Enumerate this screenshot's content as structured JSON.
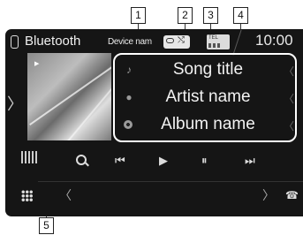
{
  "callouts": {
    "c1": "1",
    "c2": "2",
    "c3": "3",
    "c4": "4",
    "c5": "5"
  },
  "header": {
    "title": "Bluetooth",
    "device_name": "Device nam",
    "tel_label": "TEL",
    "clock": "10:00",
    "icons": [
      "phone-icon",
      "repeat-icon",
      "shuffle-icon",
      "signal-icon"
    ]
  },
  "track": {
    "song_title": "Song title",
    "artist_name": "Artist name",
    "album_name": "Album name"
  },
  "controls": [
    "eq-icon",
    "search-icon",
    "previous-icon",
    "play-icon",
    "pause-icon",
    "next-icon"
  ],
  "glyphs": {
    "side_chevron": "〉",
    "row_chevron": "〈",
    "note": "♪",
    "artist": "🌡",
    "prev": "⏮",
    "play": "▶",
    "pause": "⏸",
    "next": "⏭",
    "left": "〈",
    "right": "〉",
    "phone": "☎",
    "shuffle": "⤭",
    "tiny_play": "▶"
  },
  "colors": {
    "screen_bg": "#151515",
    "text": "#f2f2f2",
    "frame": "#ffffff",
    "callout_border": "#222222"
  }
}
